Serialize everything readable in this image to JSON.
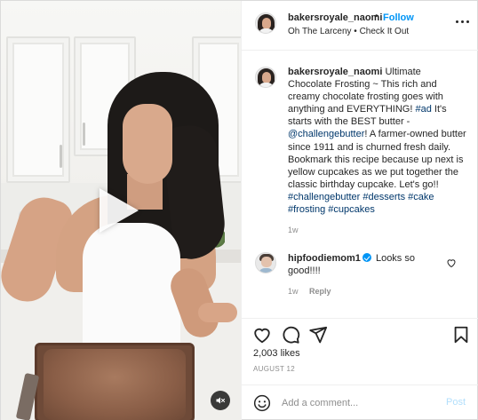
{
  "header": {
    "username": "bakersroyale_naomi",
    "separator": "•",
    "follow_label": "Follow",
    "subtitle": "Oh The Larceny • Check It Out"
  },
  "caption": {
    "username": "bakersroyale_naomi",
    "part1": "Ultimate Chocolate Frosting ~ This rich and creamy chocolate frosting goes with anything and EVERYTHING!",
    "tag_ad": "#ad",
    "part2": "It's starts with the BEST butter -",
    "mention": "@challengebutter",
    "part3": "! A farmer-owned butter since 1911 and is churned fresh daily. Bookmark this recipe because up next is yellow cupcakes as we put together the classic birthday cupcake. Let's go!!",
    "tags": [
      "#challengebutter",
      "#desserts",
      "#cake",
      "#frosting",
      "#cupcakes"
    ],
    "time": "1w"
  },
  "comment": {
    "username": "hipfoodiemom1",
    "text": "Looks so good!!!!",
    "time": "1w",
    "reply_label": "Reply"
  },
  "likes": "2,003 likes",
  "date": "AUGUST 12",
  "add_comment": {
    "placeholder": "Add a comment...",
    "post_label": "Post"
  },
  "icons": {
    "play": "play-icon",
    "mute": "speaker-muted-icon",
    "more": "more-options-icon",
    "like": "heart-icon",
    "comment": "comment-bubble-icon",
    "share": "paper-plane-icon",
    "save": "bookmark-icon",
    "emoji": "smiley-icon"
  },
  "colors": {
    "accent": "#0095f6",
    "link": "#00376b",
    "muted": "#8e8e8e",
    "post_disabled": "#b2dffc"
  }
}
